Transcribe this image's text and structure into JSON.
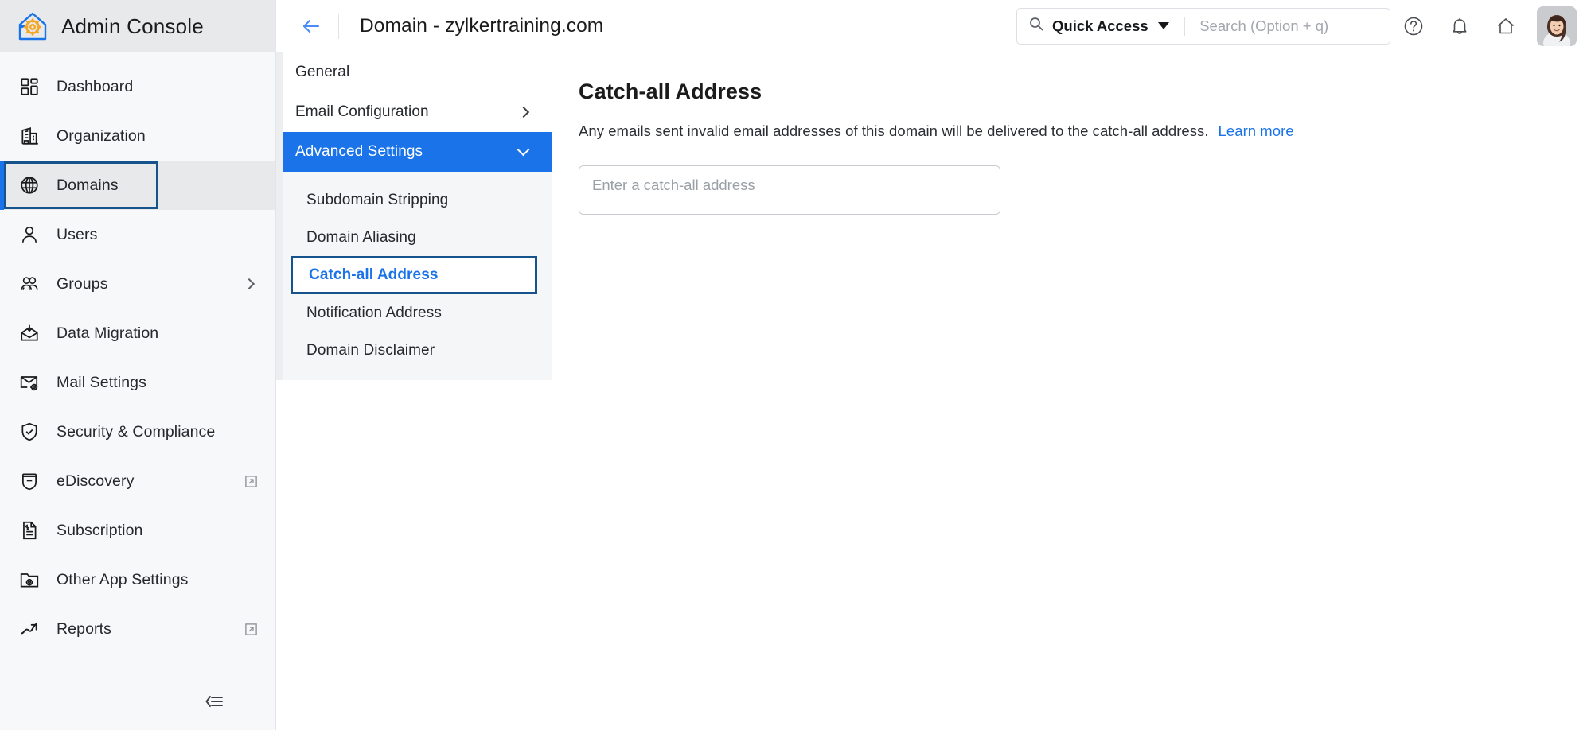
{
  "brand": {
    "title": "Admin Console",
    "logo_icon": "home-gear-logo",
    "accent_blue": "#1a73e8",
    "logo_orange": "#f5a623"
  },
  "sidebar": {
    "items": [
      {
        "label": "Dashboard",
        "icon": "dashboard-icon",
        "selected": false,
        "chevron": false,
        "external": false
      },
      {
        "label": "Organization",
        "icon": "building-icon",
        "selected": false,
        "chevron": false,
        "external": false
      },
      {
        "label": "Domains",
        "icon": "globe-icon",
        "selected": true,
        "chevron": false,
        "external": false
      },
      {
        "label": "Users",
        "icon": "user-icon",
        "selected": false,
        "chevron": false,
        "external": false
      },
      {
        "label": "Groups",
        "icon": "users-group-icon",
        "selected": false,
        "chevron": true,
        "external": false
      },
      {
        "label": "Data Migration",
        "icon": "envelope-download-icon",
        "selected": false,
        "chevron": false,
        "external": false
      },
      {
        "label": "Mail Settings",
        "icon": "envelope-gear-icon",
        "selected": false,
        "chevron": false,
        "external": false
      },
      {
        "label": "Security & Compliance",
        "icon": "shield-check-icon",
        "selected": false,
        "chevron": false,
        "external": false
      },
      {
        "label": "eDiscovery",
        "icon": "ediscovery-icon",
        "selected": false,
        "chevron": false,
        "external": true
      },
      {
        "label": "Subscription",
        "icon": "invoice-icon",
        "selected": false,
        "chevron": false,
        "external": false
      },
      {
        "label": "Other App Settings",
        "icon": "folder-gear-icon",
        "selected": false,
        "chevron": false,
        "external": false
      },
      {
        "label": "Reports",
        "icon": "trend-arrow-icon",
        "selected": false,
        "chevron": false,
        "external": true
      }
    ],
    "collapse_icon": "collapse-sidebar-icon"
  },
  "header": {
    "back_icon": "back-arrow-icon",
    "title": "Domain - zylkertraining.com",
    "quick_access_label": "Quick Access",
    "search_icon": "search-icon",
    "dropdown_icon": "caret-down-icon",
    "search_placeholder": "Search (Option + q)",
    "search_value": "",
    "help_icon": "help-circle-icon",
    "notification_icon": "bell-icon",
    "home_icon": "home-icon",
    "avatar_icon": "user-avatar"
  },
  "subnav": {
    "items": [
      {
        "label": "General",
        "state": "normal",
        "chevron": "none"
      },
      {
        "label": "Email Configuration",
        "state": "normal",
        "chevron": "right"
      },
      {
        "label": "Advanced Settings",
        "state": "active",
        "chevron": "down"
      }
    ],
    "children": [
      {
        "label": "Subdomain Stripping",
        "current": false
      },
      {
        "label": "Domain Aliasing",
        "current": false
      },
      {
        "label": "Catch-all Address",
        "current": true
      },
      {
        "label": "Notification Address",
        "current": false
      },
      {
        "label": "Domain Disclaimer",
        "current": false
      }
    ]
  },
  "main": {
    "title": "Catch-all Address",
    "description": "Any emails sent invalid email addresses of this domain will be delivered to the catch-all address.",
    "learn_more_label": "Learn more",
    "input_placeholder": "Enter a catch-all address",
    "input_value": ""
  }
}
